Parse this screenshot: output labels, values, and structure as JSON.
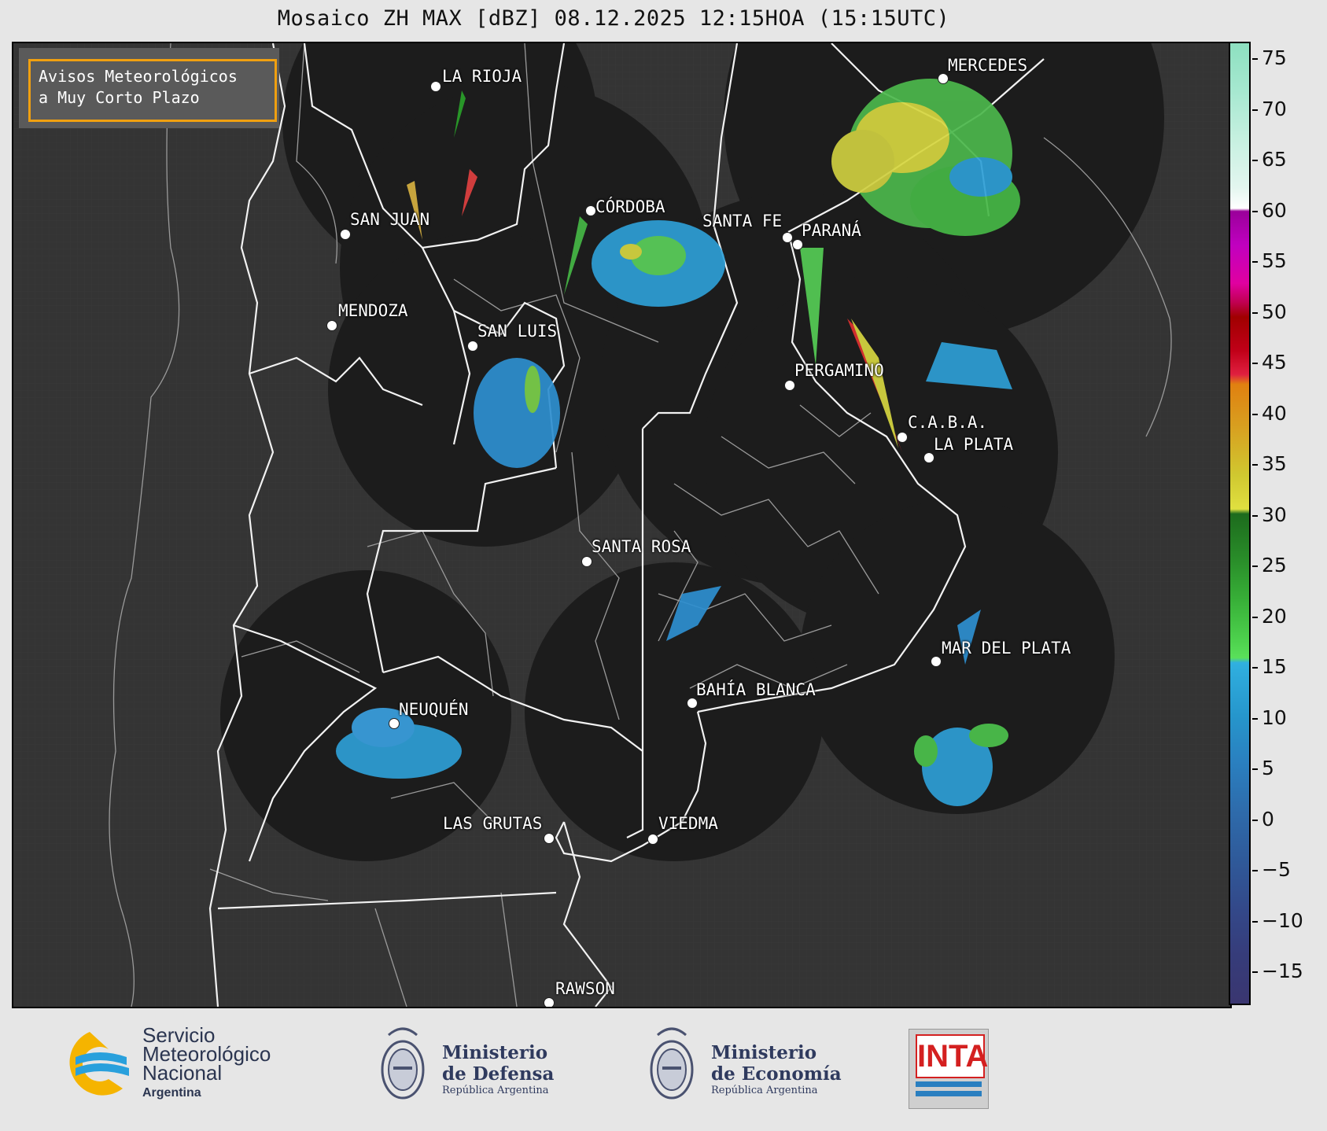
{
  "title": "Mosaico ZH MAX [dBZ] 08.12.2025 12:15HOA (15:15UTC)",
  "notice": {
    "line1": "Avisos Meteorológicos",
    "line2": "a Muy Corto Plazo"
  },
  "colorbar": {
    "unit": "dBZ",
    "ticks": [
      "75",
      "70",
      "65",
      "60",
      "55",
      "50",
      "45",
      "40",
      "35",
      "30",
      "25",
      "20",
      "15",
      "10",
      "5",
      "0",
      "−5",
      "−10",
      "−15"
    ]
  },
  "cities": [
    {
      "name": "LA RIOJA"
    },
    {
      "name": "MERCEDES"
    },
    {
      "name": "CÓRDOBA"
    },
    {
      "name": "SAN JUAN"
    },
    {
      "name": "SANTA FE"
    },
    {
      "name": "PARANÁ"
    },
    {
      "name": "MENDOZA"
    },
    {
      "name": "SAN LUIS"
    },
    {
      "name": "PERGAMINO"
    },
    {
      "name": "C.A.B.A."
    },
    {
      "name": "LA PLATA"
    },
    {
      "name": "SANTA ROSA"
    },
    {
      "name": "MAR DEL PLATA"
    },
    {
      "name": "BAHÍA BLANCA"
    },
    {
      "name": "NEUQUÉN"
    },
    {
      "name": "LAS GRUTAS"
    },
    {
      "name": "VIEDMA"
    },
    {
      "name": "RAWSON"
    }
  ],
  "footer": {
    "smn": {
      "line1": "Servicio",
      "line2": "Meteorológico",
      "line3": "Nacional",
      "line4": "Argentina"
    },
    "defensa": {
      "line1": "Ministerio",
      "line2": "de Defensa",
      "line3": "República Argentina"
    },
    "economia": {
      "line1": "Ministerio",
      "line2": "de Economía",
      "line3": "República Argentina"
    },
    "inta": {
      "text": "INTA"
    }
  }
}
